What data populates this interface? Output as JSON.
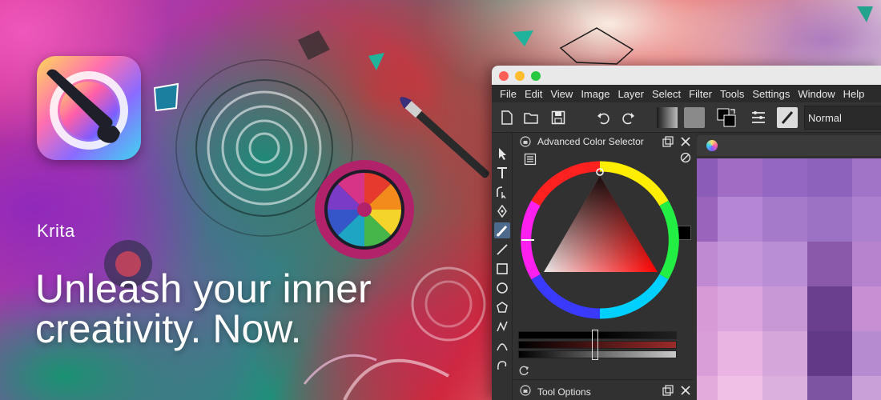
{
  "promo": {
    "app_name": "Krita",
    "tagline": "Unleash your inner creativity. Now."
  },
  "window": {
    "menu": [
      "File",
      "Edit",
      "View",
      "Image",
      "Layer",
      "Select",
      "Filter",
      "Tools",
      "Settings",
      "Window",
      "Help"
    ],
    "toolbar": {
      "blend_mode": "Normal",
      "icons": [
        "new-document-icon",
        "open-folder-icon",
        "save-icon",
        "undo-icon",
        "redo-icon",
        "gradient-icon",
        "pattern-icon",
        "color-swap-icon",
        "brush-settings-icon",
        "brush-preset-icon"
      ]
    },
    "toolbox": [
      "select-cursor-icon",
      "text-tool-icon",
      "edit-shapes-icon",
      "calligraphy-pen-icon",
      "freehand-brush-icon",
      "line-tool-icon",
      "rectangle-tool-icon",
      "ellipse-tool-icon",
      "polygon-tool-icon",
      "polyline-tool-icon",
      "bezier-tool-icon",
      "freehand-path-icon"
    ],
    "dockers": {
      "color_selector_title": "Advanced Color Selector",
      "tool_options_title": "Tool Options"
    },
    "colors": {
      "accent": "#4d6a8c",
      "foreground": "#000000",
      "selected_hue": "#ff0000"
    }
  }
}
